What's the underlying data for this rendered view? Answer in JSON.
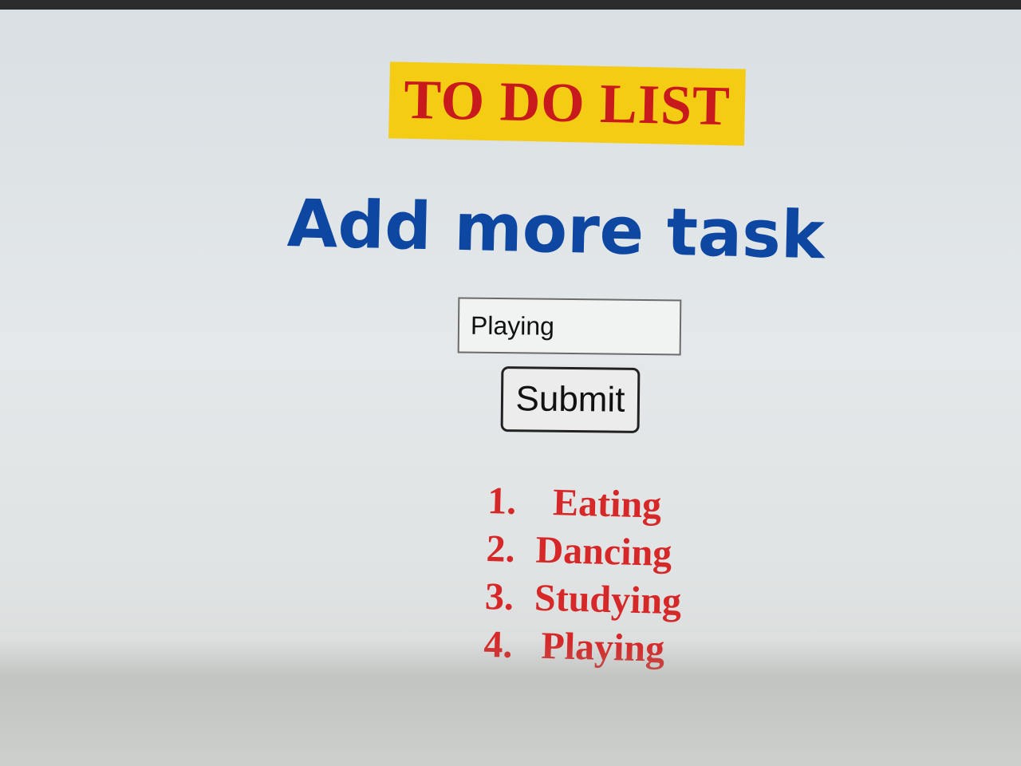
{
  "header": {
    "title": "TO DO LIST",
    "subtitle": "Add more task"
  },
  "form": {
    "input_value": "Playing",
    "submit_label": "Submit"
  },
  "tasks": [
    {
      "number": "1.",
      "label": "Eating"
    },
    {
      "number": "2.",
      "label": "Dancing"
    },
    {
      "number": "3.",
      "label": "Studying"
    },
    {
      "number": "4.",
      "label": "Playing"
    }
  ],
  "colors": {
    "title_text": "#c8191d",
    "title_highlight": "#f5cc14",
    "subtitle_text": "#0d47a1",
    "task_text": "#d62828",
    "background": "#e4e8ea"
  }
}
